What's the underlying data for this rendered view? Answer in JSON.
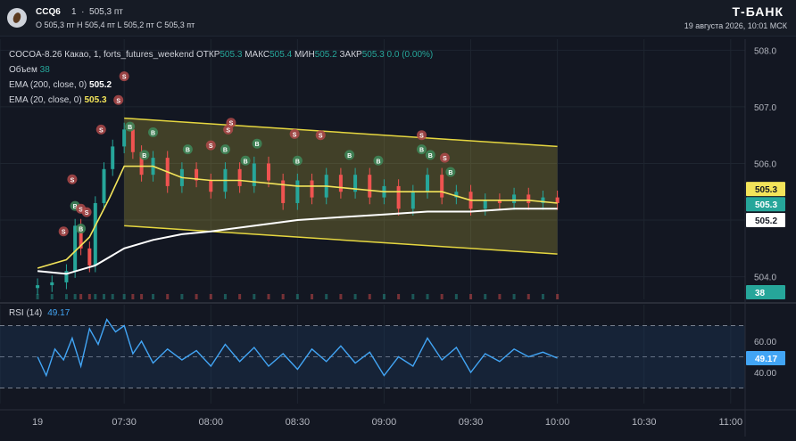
{
  "header": {
    "symbol": "CCQ6",
    "interval": "1",
    "last_price": "505,3 пт",
    "ohlc": "O 505,3 пт  H 505,4 пт  L 505,2 пт  C 505,3 пт",
    "brand": "Т-БАНК",
    "datetime": "19 августа 2026, 10:01 МСК"
  },
  "legend": {
    "title": "COCOA-8.26 Какао, 1, forts_futures_weekend",
    "open_label": "ОТКР",
    "open_value": "505.3",
    "high_label": "МАКС",
    "high_value": "505.4",
    "low_label": "МИН",
    "low_value": "505.2",
    "close_label": "ЗАКР",
    "close_value": "505.3",
    "change": "0.0 (0.00%)",
    "volume_label": "Объем",
    "volume_value": "38",
    "ema200_label": "EMA (200, close, 0)",
    "ema200_value": "505.2",
    "ema20_label": "EMA (20, close, 0)",
    "ema20_value": "505.3",
    "rsi_label": "RSI (14)",
    "rsi_value": "49.17"
  },
  "colors": {
    "up": "#26a69a",
    "down": "#ef5350",
    "ema20": "#f3e45a",
    "ema200": "#ffffff",
    "rsi": "#42a5f5",
    "channel": "#e6d740",
    "background": "#131722"
  },
  "price_badges": {
    "ema20": "505.3",
    "close": "505.3",
    "ema200": "505.2",
    "volume": "38",
    "rsi": "49.17"
  },
  "chart_data": {
    "type": "candlestick",
    "instrument": "COCOA-8.26",
    "interval": "1",
    "ylim": [
      503.6,
      508.1
    ],
    "yticks": [
      504.0,
      505.0,
      506.0,
      507.0,
      508.0
    ],
    "ytick_labels": [
      "504.0",
      "505.0",
      "506.0",
      "507.0",
      "508.0"
    ],
    "xticks": [
      "19",
      "07:30",
      "08:00",
      "08:30",
      "09:00",
      "09:30",
      "10:00",
      "10:30",
      "11:00"
    ],
    "price_series": [
      {
        "t": "07:00",
        "v": 503.85
      },
      {
        "t": "07:05",
        "v": 503.9
      },
      {
        "t": "07:10",
        "v": 504.1
      },
      {
        "t": "07:13",
        "v": 504.9
      },
      {
        "t": "07:15",
        "v": 504.5
      },
      {
        "t": "07:18",
        "v": 504.2
      },
      {
        "t": "07:20",
        "v": 505.3
      },
      {
        "t": "07:23",
        "v": 505.9
      },
      {
        "t": "07:26",
        "v": 506.3
      },
      {
        "t": "07:30",
        "v": 506.6
      },
      {
        "t": "07:33",
        "v": 506.2
      },
      {
        "t": "07:36",
        "v": 505.8
      },
      {
        "t": "07:40",
        "v": 506.1
      },
      {
        "t": "07:45",
        "v": 505.6
      },
      {
        "t": "07:50",
        "v": 505.9
      },
      {
        "t": "07:55",
        "v": 505.7
      },
      {
        "t": "08:00",
        "v": 505.5
      },
      {
        "t": "08:05",
        "v": 505.9
      },
      {
        "t": "08:10",
        "v": 505.6
      },
      {
        "t": "08:15",
        "v": 506.0
      },
      {
        "t": "08:20",
        "v": 505.7
      },
      {
        "t": "08:25",
        "v": 505.3
      },
      {
        "t": "08:30",
        "v": 505.7
      },
      {
        "t": "08:35",
        "v": 505.4
      },
      {
        "t": "08:40",
        "v": 505.8
      },
      {
        "t": "08:45",
        "v": 505.5
      },
      {
        "t": "08:50",
        "v": 505.8
      },
      {
        "t": "08:55",
        "v": 505.4
      },
      {
        "t": "09:00",
        "v": 505.6
      },
      {
        "t": "09:05",
        "v": 505.2
      },
      {
        "t": "09:10",
        "v": 505.5
      },
      {
        "t": "09:15",
        "v": 505.8
      },
      {
        "t": "09:20",
        "v": 505.4
      },
      {
        "t": "09:25",
        "v": 505.5
      },
      {
        "t": "09:30",
        "v": 505.2
      },
      {
        "t": "09:35",
        "v": 505.35
      },
      {
        "t": "09:40",
        "v": 505.3
      },
      {
        "t": "09:45",
        "v": 505.45
      },
      {
        "t": "09:50",
        "v": 505.3
      },
      {
        "t": "09:55",
        "v": 505.4
      },
      {
        "t": "10:00",
        "v": 505.3
      }
    ],
    "ema20": [
      {
        "t": "07:00",
        "v": 504.15
      },
      {
        "t": "07:10",
        "v": 504.3
      },
      {
        "t": "07:18",
        "v": 504.7
      },
      {
        "t": "07:25",
        "v": 505.4
      },
      {
        "t": "07:30",
        "v": 505.95
      },
      {
        "t": "07:40",
        "v": 505.95
      },
      {
        "t": "07:50",
        "v": 505.75
      },
      {
        "t": "08:00",
        "v": 505.7
      },
      {
        "t": "08:10",
        "v": 505.7
      },
      {
        "t": "08:20",
        "v": 505.65
      },
      {
        "t": "08:30",
        "v": 505.6
      },
      {
        "t": "08:40",
        "v": 505.6
      },
      {
        "t": "08:50",
        "v": 505.55
      },
      {
        "t": "09:00",
        "v": 505.5
      },
      {
        "t": "09:10",
        "v": 505.5
      },
      {
        "t": "09:20",
        "v": 505.5
      },
      {
        "t": "09:30",
        "v": 505.35
      },
      {
        "t": "09:40",
        "v": 505.35
      },
      {
        "t": "09:50",
        "v": 505.35
      },
      {
        "t": "10:00",
        "v": 505.3
      }
    ],
    "ema200": [
      {
        "t": "07:00",
        "v": 504.1
      },
      {
        "t": "07:10",
        "v": 504.05
      },
      {
        "t": "07:20",
        "v": 504.2
      },
      {
        "t": "07:30",
        "v": 504.5
      },
      {
        "t": "07:40",
        "v": 504.65
      },
      {
        "t": "07:50",
        "v": 504.75
      },
      {
        "t": "08:00",
        "v": 504.8
      },
      {
        "t": "08:15",
        "v": 504.9
      },
      {
        "t": "08:30",
        "v": 505.0
      },
      {
        "t": "08:45",
        "v": 505.05
      },
      {
        "t": "09:00",
        "v": 505.1
      },
      {
        "t": "09:15",
        "v": 505.15
      },
      {
        "t": "09:30",
        "v": 505.15
      },
      {
        "t": "09:45",
        "v": 505.2
      },
      {
        "t": "10:00",
        "v": 505.2
      }
    ],
    "channel": {
      "upper": [
        {
          "t": "07:30",
          "v": 506.8
        },
        {
          "t": "10:00",
          "v": 506.3
        }
      ],
      "lower": [
        {
          "t": "07:30",
          "v": 504.9
        },
        {
          "t": "10:00",
          "v": 504.4
        }
      ]
    },
    "signals": [
      {
        "t": "07:09",
        "type": "S"
      },
      {
        "t": "07:12",
        "type": "S"
      },
      {
        "t": "07:13",
        "type": "B"
      },
      {
        "t": "07:15",
        "type": "S"
      },
      {
        "t": "07:15",
        "type": "B"
      },
      {
        "t": "07:17",
        "type": "S"
      },
      {
        "t": "07:22",
        "type": "S"
      },
      {
        "t": "07:28",
        "type": "S"
      },
      {
        "t": "07:30",
        "type": "S"
      },
      {
        "t": "07:32",
        "type": "B"
      },
      {
        "t": "07:37",
        "type": "B"
      },
      {
        "t": "07:40",
        "type": "B"
      },
      {
        "t": "07:52",
        "type": "B"
      },
      {
        "t": "08:00",
        "type": "S"
      },
      {
        "t": "08:05",
        "type": "B"
      },
      {
        "t": "08:06",
        "type": "S"
      },
      {
        "t": "08:07",
        "type": "S"
      },
      {
        "t": "08:12",
        "type": "B"
      },
      {
        "t": "08:16",
        "type": "B"
      },
      {
        "t": "08:29",
        "type": "S"
      },
      {
        "t": "08:30",
        "type": "B"
      },
      {
        "t": "08:38",
        "type": "S"
      },
      {
        "t": "08:48",
        "type": "B"
      },
      {
        "t": "08:58",
        "type": "B"
      },
      {
        "t": "09:13",
        "type": "S"
      },
      {
        "t": "09:13",
        "type": "B"
      },
      {
        "t": "09:16",
        "type": "B"
      },
      {
        "t": "09:21",
        "type": "S"
      },
      {
        "t": "09:23",
        "type": "B"
      }
    ],
    "volume_last": 38
  },
  "rsi_data": {
    "ylim": [
      20,
      80
    ],
    "levels": [
      70,
      50,
      30
    ],
    "yticks": [
      "60.00",
      "40.00"
    ],
    "values": [
      {
        "t": "07:00",
        "v": 50
      },
      {
        "t": "07:03",
        "v": 38
      },
      {
        "t": "07:06",
        "v": 55
      },
      {
        "t": "07:09",
        "v": 48
      },
      {
        "t": "07:12",
        "v": 62
      },
      {
        "t": "07:15",
        "v": 44
      },
      {
        "t": "07:18",
        "v": 68
      },
      {
        "t": "07:21",
        "v": 58
      },
      {
        "t": "07:24",
        "v": 74
      },
      {
        "t": "07:27",
        "v": 66
      },
      {
        "t": "07:30",
        "v": 70
      },
      {
        "t": "07:33",
        "v": 52
      },
      {
        "t": "07:36",
        "v": 60
      },
      {
        "t": "07:40",
        "v": 46
      },
      {
        "t": "07:45",
        "v": 55
      },
      {
        "t": "07:50",
        "v": 48
      },
      {
        "t": "07:55",
        "v": 54
      },
      {
        "t": "08:00",
        "v": 44
      },
      {
        "t": "08:05",
        "v": 58
      },
      {
        "t": "08:10",
        "v": 47
      },
      {
        "t": "08:15",
        "v": 56
      },
      {
        "t": "08:20",
        "v": 44
      },
      {
        "t": "08:25",
        "v": 52
      },
      {
        "t": "08:30",
        "v": 42
      },
      {
        "t": "08:35",
        "v": 55
      },
      {
        "t": "08:40",
        "v": 47
      },
      {
        "t": "08:45",
        "v": 57
      },
      {
        "t": "08:50",
        "v": 46
      },
      {
        "t": "08:55",
        "v": 53
      },
      {
        "t": "09:00",
        "v": 38
      },
      {
        "t": "09:05",
        "v": 50
      },
      {
        "t": "09:10",
        "v": 44
      },
      {
        "t": "09:15",
        "v": 62
      },
      {
        "t": "09:20",
        "v": 48
      },
      {
        "t": "09:25",
        "v": 56
      },
      {
        "t": "09:30",
        "v": 40
      },
      {
        "t": "09:35",
        "v": 52
      },
      {
        "t": "09:40",
        "v": 47
      },
      {
        "t": "09:45",
        "v": 55
      },
      {
        "t": "09:50",
        "v": 50
      },
      {
        "t": "09:55",
        "v": 53
      },
      {
        "t": "10:00",
        "v": 49.17
      }
    ]
  }
}
